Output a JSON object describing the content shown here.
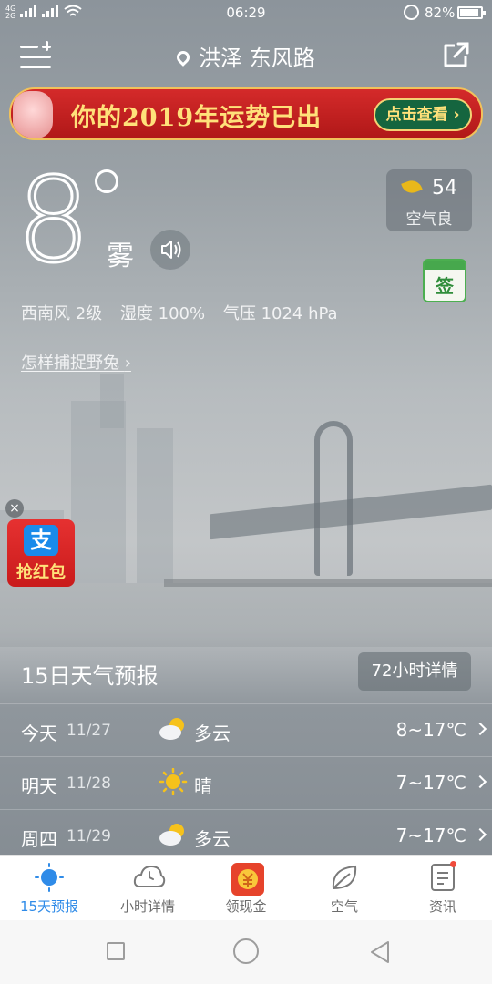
{
  "status_bar": {
    "time": "06:29",
    "network_top": "4G",
    "network_bottom": "2G",
    "network2": "2G",
    "battery": "82%",
    "battery_level": 0.82
  },
  "header": {
    "location": "洪泽 东风路"
  },
  "banner": {
    "title": "你的2019年运势已出",
    "cta": "点击查看",
    "cta_arrow": "›"
  },
  "current": {
    "temperature": "8",
    "condition": "雾",
    "aqi_value": "54",
    "aqi_label": "空气良",
    "sign_label": "签",
    "wind": "西南风 2级",
    "humidity": "湿度 100%",
    "pressure": "气压 1024 hPa",
    "tip": "怎样捕捉野兔",
    "tip_arrow": "›"
  },
  "red_packet": {
    "close": "×",
    "icon_text": "支",
    "label": "抢红包"
  },
  "forecast": {
    "title": "15日天气预报",
    "button": "72小时详情",
    "days": [
      {
        "day": "今天",
        "date": "11/27",
        "icon": "partly-cloudy-icon",
        "condition": "多云",
        "range": "8~17℃"
      },
      {
        "day": "明天",
        "date": "11/28",
        "icon": "sunny-icon",
        "condition": "晴",
        "range": "7~17℃"
      },
      {
        "day": "周四",
        "date": "11/29",
        "icon": "partly-cloudy-icon",
        "condition": "多云",
        "range": "7~17℃"
      }
    ]
  },
  "bottom_nav": [
    {
      "label": "15天预报",
      "icon": "sun-icon",
      "active": true
    },
    {
      "label": "小时详情",
      "icon": "cloud-icon",
      "active": false
    },
    {
      "label": "领现金",
      "icon": "cash-icon",
      "active": false
    },
    {
      "label": "空气",
      "icon": "leaf-icon",
      "active": false
    },
    {
      "label": "资讯",
      "icon": "news-icon",
      "active": false,
      "badge": true
    }
  ],
  "colors": {
    "active_tab": "#2f8be8",
    "banner_red": "#c41f1f",
    "banner_gold": "#ffe17a",
    "aqi_leaf": "#e9b81a"
  }
}
